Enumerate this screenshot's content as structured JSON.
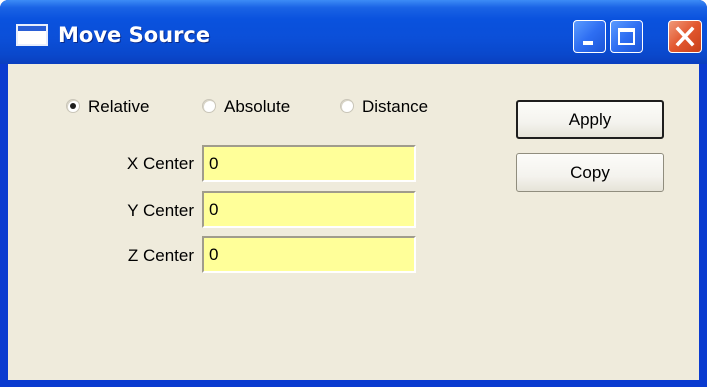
{
  "window": {
    "title": "Move Source",
    "icon": "window-icon",
    "controls": {
      "minimize": "minimize-icon",
      "maximize": "maximize-icon",
      "close": "close-icon"
    }
  },
  "mode": {
    "options": [
      {
        "label": "Relative",
        "checked": true
      },
      {
        "label": "Absolute",
        "checked": false
      },
      {
        "label": "Distance",
        "checked": false
      }
    ]
  },
  "fields": [
    {
      "label": "X Center",
      "value": "0"
    },
    {
      "label": "Y Center",
      "value": "0"
    },
    {
      "label": "Z Center",
      "value": "0"
    }
  ],
  "buttons": {
    "apply_label": "Apply",
    "copy_label": "Copy"
  },
  "colors": {
    "titlebar": "#0b4fd8",
    "client_background": "#efebdc",
    "field_background": "#ffff99",
    "close_button": "#e2572e"
  }
}
